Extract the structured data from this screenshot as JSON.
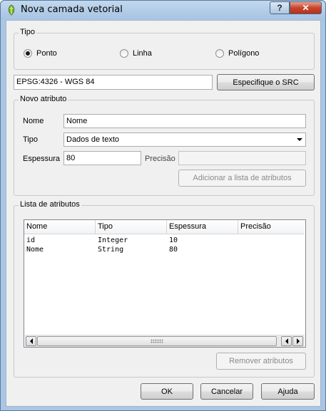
{
  "window": {
    "title": "Nova camada vetorial",
    "help_label": "?",
    "close_label": "✕"
  },
  "tipo_group": {
    "title": "Tipo",
    "options": [
      {
        "label": "Ponto",
        "checked": true
      },
      {
        "label": "Linha",
        "checked": false
      },
      {
        "label": "Polígono",
        "checked": false
      }
    ]
  },
  "crs": {
    "value": "EPSG:4326 - WGS 84",
    "button_label": "Especifique o SRC"
  },
  "novo_atributo": {
    "title": "Novo atributo",
    "nome_label": "Nome",
    "nome_value": "Nome",
    "tipo_label": "Tipo",
    "tipo_value": "Dados de texto",
    "espessura_label": "Espessura",
    "espessura_value": "80",
    "precisao_label": "Precisão",
    "precisao_value": "",
    "add_button_label": "Adicionar a lista de atributos"
  },
  "lista": {
    "title": "Lista de atributos",
    "columns": [
      "Nome",
      "Tipo",
      "Espessura",
      "Precisão"
    ],
    "rows": [
      [
        "id",
        "Integer",
        "10",
        ""
      ],
      [
        "Nome",
        "String",
        "80",
        ""
      ]
    ],
    "remove_button_label": "Remover atributos"
  },
  "footer": {
    "ok_label": "OK",
    "cancel_label": "Cancelar",
    "help_label": "Ajuda"
  },
  "colors": {
    "frame": "#a9c6e4",
    "close_button": "#c7452d",
    "dialog_background": "#f0f0f0"
  },
  "icons": {
    "title_icon": "qgis-leaf-icon"
  }
}
